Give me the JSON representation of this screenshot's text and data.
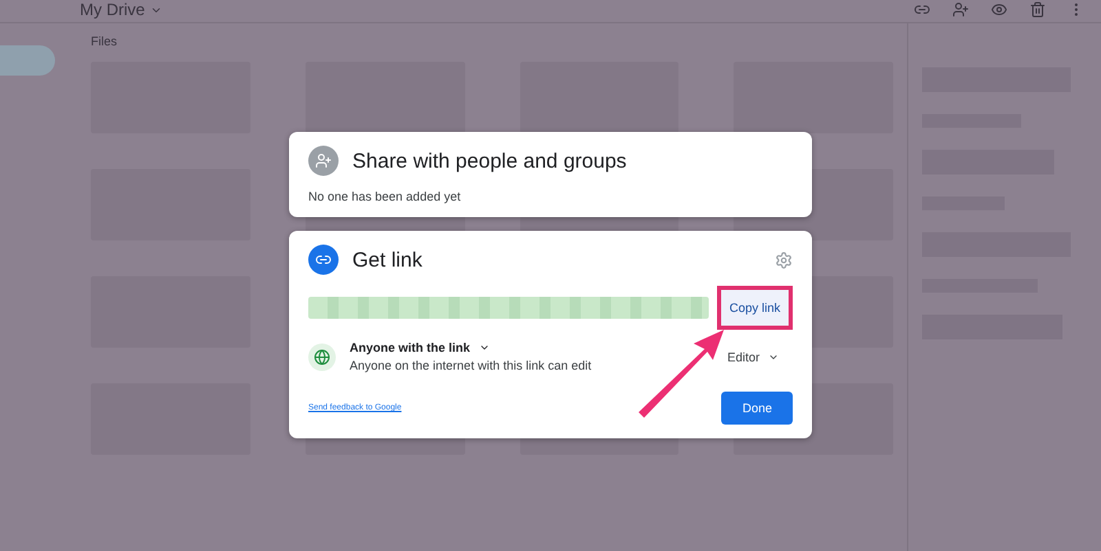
{
  "top_bar": {
    "title": "My Drive"
  },
  "section_label": "Files",
  "share_card": {
    "title": "Share with people and groups",
    "subtitle": "No one has been added yet"
  },
  "link_card": {
    "title": "Get link",
    "copy_button": "Copy link",
    "copy_highlighted": true,
    "access": {
      "label": "Anyone with the link",
      "description": "Anyone on the internet with this link can edit",
      "role": "Editor"
    },
    "feedback_link": "Send feedback to Google",
    "done_button": "Done"
  }
}
